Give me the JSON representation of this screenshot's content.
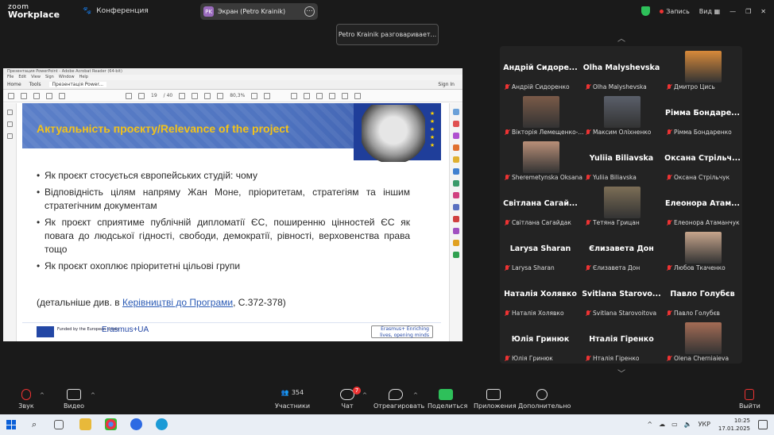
{
  "topbar": {
    "app_line1": "zoom",
    "app_line2": "Workplace",
    "conference_label": "Конференция",
    "share_badge": "PK",
    "share_label": "Экран (Petro Krainik)",
    "record_label": "Запись",
    "view_label": "Вид",
    "speaking_tooltip": "Petro Krainik разговаривает..."
  },
  "acrobat": {
    "title": "Презентация PowerPoint - Adobe Acrobat Reader (64-bit)",
    "menu": [
      "File",
      "Edit",
      "View",
      "Sign",
      "Window",
      "Help"
    ],
    "tabs": [
      "Home",
      "Tools",
      "Презентація Power..."
    ],
    "sign_in": "Sign In",
    "page_current": "19",
    "page_total": "/ 40",
    "zoom": "80,3%"
  },
  "slide": {
    "title": "Актуальність проєкту/Relevance of the project",
    "bullets": [
      "Як проєкт стосується європейських студій: чому",
      "Відповідність цілям напряму Жан Моне, пріоритетам, стратегіям та іншим стратегічним документам",
      "Як проєкт сприятиме публічній дипломатії ЄС, поширенню цінностей ЄС як повага до людської гідності, свободи, демократії, рівності, верховенства права тощо",
      "Як проєкт охоплює пріоритетні цільові групи"
    ],
    "detail_prefix": "(детальніше див. в ",
    "detail_link": "Керівництві до Програми",
    "detail_suffix": ", С.372-378)",
    "footer_funded": "Funded by the European Union",
    "footer_erasmus": "Erasmus+UA",
    "footer_erasmus_right": "Erasmus+ Enriching lives, opening minds"
  },
  "participants": [
    {
      "big": "Андрій Сидоре...",
      "label": "Андрій Сидоренко"
    },
    {
      "big": "Olha Malyshevska",
      "label": "Olha Malyshevska"
    },
    {
      "big": "",
      "label": "Дмитро Цись",
      "photo": "#d98a3a"
    },
    {
      "big": "",
      "label": "Вікторія Лемещенко-...",
      "photo": "#7a5a48"
    },
    {
      "big": "",
      "label": "Максим Оліхненко",
      "photo": "#5a5f6a"
    },
    {
      "big": "Рімма Бондаре...",
      "label": "Рімма Бондаренко"
    },
    {
      "big": "",
      "label": "Sheremetynska Oksana",
      "photo": "#b98f78"
    },
    {
      "big": "Yuliia Biliavska",
      "label": "Yuliia Biliavska"
    },
    {
      "big": "Оксана Стрільч...",
      "label": "Оксана Стрільчук"
    },
    {
      "big": "Світлана Сагай...",
      "label": "Світлана Сагайдак"
    },
    {
      "big": "",
      "label": "Тетяна Грицан",
      "photo": "#7c6e56"
    },
    {
      "big": "Елеонора Атам...",
      "label": "Елеонора Атаманчук"
    },
    {
      "big": "Larysa Sharan",
      "label": "Larysa Sharan"
    },
    {
      "big": "Єлизавета Дон",
      "label": "Єлизавета Дон"
    },
    {
      "big": "",
      "label": "Любов Ткаченко",
      "photo": "#c7a58c"
    },
    {
      "big": "Наталія Холявко",
      "label": "Наталія Холявко"
    },
    {
      "big": "Svitlana Starovo...",
      "label": "Svitlana Starovoitova"
    },
    {
      "big": "Павло Голубєв",
      "label": "Павло Голубєв"
    },
    {
      "big": "Юлія Гринюк",
      "label": "Юлія Гринюк"
    },
    {
      "big": "Нталія Гіренко",
      "label": "Нталія Гіренко"
    },
    {
      "big": "",
      "label": "Olena Cherniaieva",
      "photo": "#a46c55"
    }
  ],
  "toolbar": {
    "audio": "Звук",
    "video": "Видео",
    "participants": "Участники",
    "participants_count": "354",
    "chat": "Чат",
    "chat_badge": "7",
    "react": "Отреагировать",
    "share": "Поделиться",
    "apps": "Приложения",
    "more": "Дополнительно",
    "leave": "Выйти"
  },
  "taskbar": {
    "lang": "УКР",
    "time": "10:25",
    "date": "17.01.2025"
  },
  "colors": {
    "muted_red": "#e33333",
    "share_green": "#2ec05a",
    "slide_title_yellow": "#f2c21b",
    "slide_head_blue": "#4f74c0"
  }
}
